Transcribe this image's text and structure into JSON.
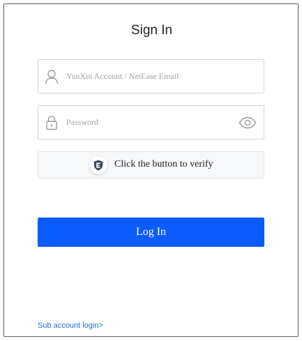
{
  "form": {
    "title": "Sign In",
    "account": {
      "placeholder": "YunXin Account / NetEase Email",
      "value": "",
      "icon": "user-icon"
    },
    "password": {
      "placeholder": "Password",
      "value": "",
      "icon": "lock-icon",
      "toggle_icon": "eye-icon"
    },
    "verify": {
      "label": "Click the button to verify",
      "icon": "shield-icon"
    },
    "login_button": "Log In",
    "sub_account_link": "Sub account login>"
  },
  "colors": {
    "primary": "#0a5cff",
    "link": "#1a6fd6",
    "border": "#d6d6d6",
    "verify_bg": "#f7f8fa"
  }
}
